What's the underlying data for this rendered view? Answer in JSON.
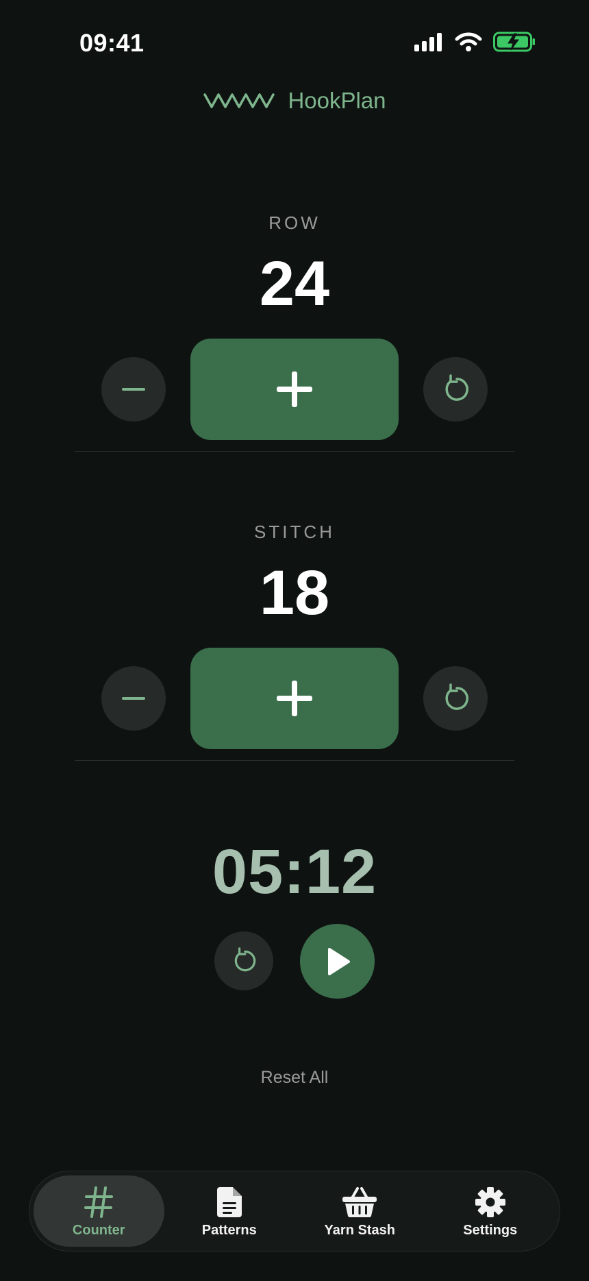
{
  "status_bar": {
    "time": "09:41"
  },
  "header": {
    "app_name": "HookPlan",
    "logo_icon": "zigzag-stitch-icon"
  },
  "counters": [
    {
      "label": "ROW",
      "value": "24"
    },
    {
      "label": "STITCH",
      "value": "18"
    }
  ],
  "timer": {
    "value": "05:12"
  },
  "reset_all_label": "Reset All",
  "tab_bar": {
    "tabs": [
      {
        "label": "Counter",
        "icon": "hash-icon",
        "active": true
      },
      {
        "label": "Patterns",
        "icon": "document-icon",
        "active": false
      },
      {
        "label": "Yarn Stash",
        "icon": "basket-icon",
        "active": false
      },
      {
        "label": "Settings",
        "icon": "gear-icon",
        "active": false
      }
    ]
  },
  "colors": {
    "background": "#0e1311",
    "accent": "#3b6f4c",
    "accent_text": "#7fb58d",
    "timer_text": "#a6bfae"
  }
}
